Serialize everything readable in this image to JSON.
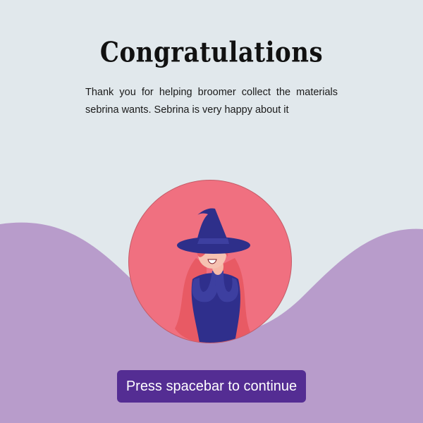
{
  "title": "Congratulations",
  "message": "Thank you for helping broomer collect the materials sebrina wants. Sebrina is very happy about it",
  "continue_button": {
    "label": "Press spacebar to continue"
  },
  "colors": {
    "background": "#e1e8ec",
    "wave": "#b89ccb",
    "portrait_circle": "#f07080",
    "button": "#542d93",
    "witch_hat": "#2e2f8a",
    "witch_dress": "#3d3fa0",
    "witch_hair": "#e85a64"
  },
  "portrait": {
    "subject": "witch-character"
  }
}
